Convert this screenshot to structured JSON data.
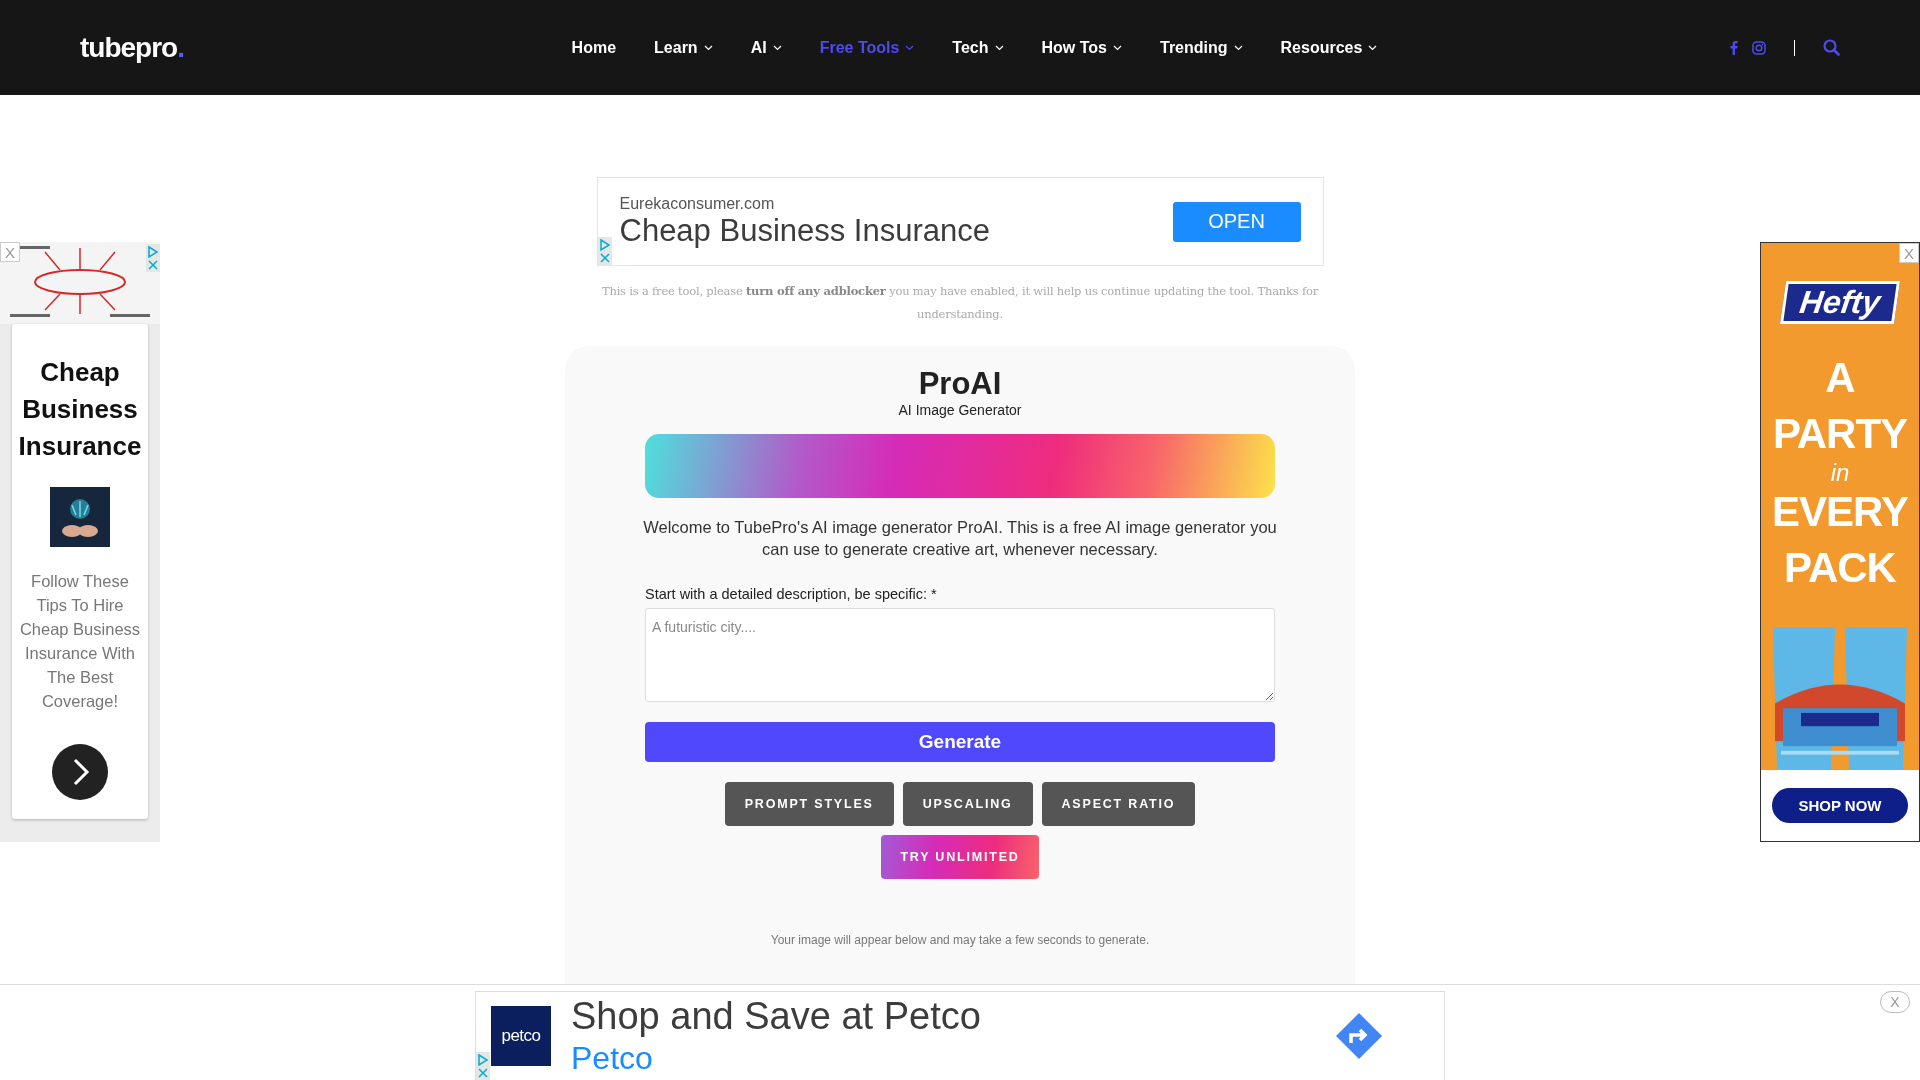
{
  "header": {
    "logo": "tubepro",
    "logo_dot": ".",
    "nav": [
      {
        "label": "Home",
        "has_menu": false,
        "selected": false
      },
      {
        "label": "Learn",
        "has_menu": true,
        "selected": false
      },
      {
        "label": "AI",
        "has_menu": true,
        "selected": false
      },
      {
        "label": "Free Tools",
        "has_menu": true,
        "selected": true
      },
      {
        "label": "Tech",
        "has_menu": true,
        "selected": false
      },
      {
        "label": "How Tos",
        "has_menu": true,
        "selected": false
      },
      {
        "label": "Trending",
        "has_menu": true,
        "selected": false
      },
      {
        "label": "Resources",
        "has_menu": true,
        "selected": false
      }
    ]
  },
  "top_ad": {
    "domain": "Eurekaconsumer.com",
    "headline": "Cheap Business Insurance",
    "button": "OPEN"
  },
  "notice": "This is a free tool, please **turn off any adblocker** you may have enabled, it will help us continue updating the tool. Thanks for understanding.",
  "tool": {
    "title": "ProAI",
    "subtitle": "AI Image Generator",
    "intro": "Welcome to TubePro's AI image generator ProAI. This is a free AI image generator you can use to generate creative art, whenever necessary.",
    "prompt_label": "Start with a detailed description, be specific: *",
    "placeholder": "A futuristic city....",
    "generate": "Generate",
    "options": [
      "PROMPT STYLES",
      "UPSCALING",
      "ASPECT RATIO"
    ],
    "upgrade": "TRY UNLIMITED",
    "footnote": "Your image will appear below and may take a few seconds to generate."
  },
  "left_ad": {
    "close": "X",
    "headline": "Cheap Business Insurance",
    "body": "Follow These Tips To Hire Cheap Business Insurance With The Best Coverage!"
  },
  "right_ad": {
    "close": "X",
    "brand": "Hefty",
    "slogan": [
      {
        "text": "A",
        "kind": "big"
      },
      {
        "text": "PARTY",
        "kind": "big"
      },
      {
        "text": "in",
        "kind": "small"
      },
      {
        "text": "EVERY",
        "kind": "big"
      },
      {
        "text": "PACK",
        "kind": "big"
      }
    ],
    "button": "SHOP NOW"
  },
  "bottom_ad": {
    "logo": "petco",
    "headline": "Shop and Save at Petco",
    "advertiser": "Petco",
    "close": "X"
  }
}
